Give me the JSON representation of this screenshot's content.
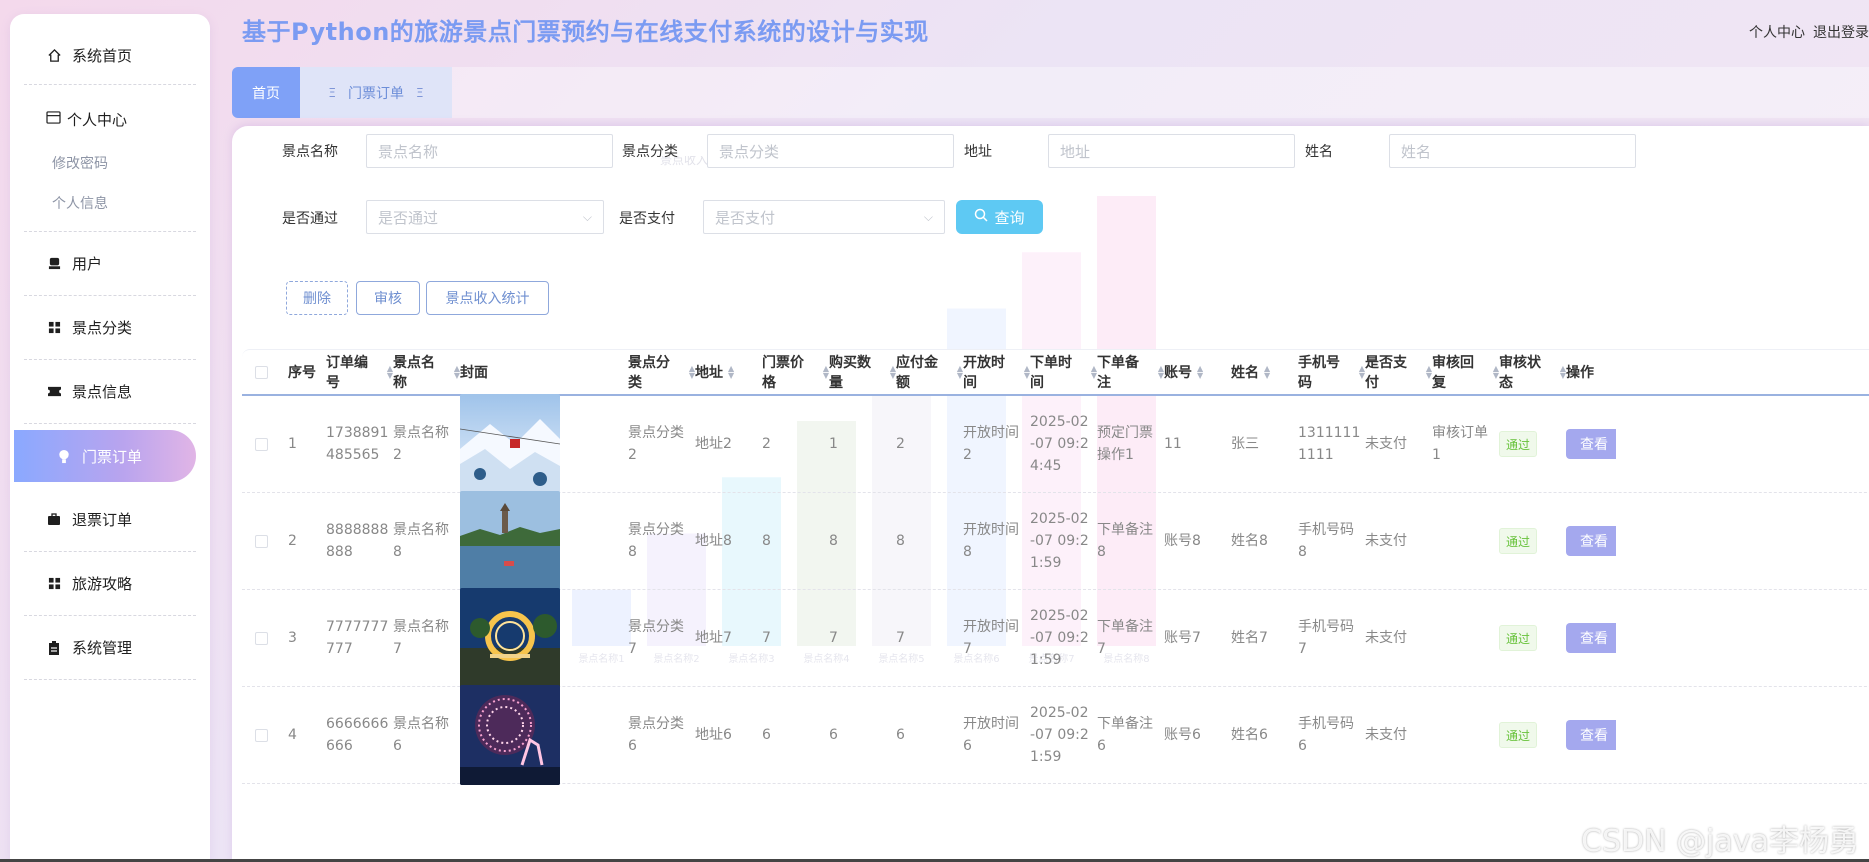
{
  "header": {
    "title": "基于Python的旅游景点门票预约与在线支付系统的设计与实现",
    "personal_center": "个人中心",
    "logout": "退出登录"
  },
  "sidebar": {
    "home": "系统首页",
    "personal": "个人中心",
    "personal_sub": [
      "修改密码",
      "个人信息"
    ],
    "items": [
      {
        "label": "用户",
        "icon": "user-icon"
      },
      {
        "label": "景点分类",
        "icon": "grid-icon"
      },
      {
        "label": "景点信息",
        "icon": "ticket-icon"
      },
      {
        "label": "门票订单",
        "icon": "bulb-icon"
      },
      {
        "label": "退票订单",
        "icon": "briefcase-icon"
      },
      {
        "label": "旅游攻略",
        "icon": "grid-icon"
      },
      {
        "label": "系统管理",
        "icon": "clipboard-icon"
      }
    ],
    "active": "门票订单"
  },
  "tabs": {
    "home": "首页",
    "order": "门票订单"
  },
  "search": {
    "name_label": "景点名称",
    "name_placeholder": "景点名称",
    "category_label": "景点分类",
    "category_placeholder": "景点分类",
    "address_label": "地址",
    "address_placeholder": "地址",
    "person_label": "姓名",
    "person_placeholder": "姓名",
    "pass_label": "是否通过",
    "pass_placeholder": "是否通过",
    "paid_label": "是否支付",
    "paid_placeholder": "是否支付",
    "query": "查询"
  },
  "actions": {
    "delete": "删除",
    "review": "审核",
    "stats": "景点收入统计"
  },
  "ghost_chart": {
    "title": "景点收入统计",
    "categories": [
      "景点名称1",
      "景点名称2",
      "景点名称3",
      "景点名称4",
      "景点名称5",
      "景点名称6",
      "景点名称7",
      "景点名称8"
    ],
    "values": [
      1,
      2,
      3,
      4,
      5,
      6,
      7,
      8
    ],
    "ylim": [
      0,
      8
    ],
    "colors": [
      "#dfe7ff",
      "#ede8fb",
      "#d6f3fb",
      "#e7eee3",
      "#f1eef6",
      "#e3ecff",
      "#fbe6f5",
      "#fbdcf0"
    ]
  },
  "table": {
    "columns": [
      "序号",
      "订单编号",
      "景点名称",
      "封面",
      "景点分类",
      "地址",
      "门票价格",
      "购买数量",
      "应付金额",
      "开放时间",
      "下单时间",
      "下单备注",
      "账号",
      "姓名",
      "手机号码",
      "是否支付",
      "审核回复",
      "审核状态",
      "操作"
    ],
    "rows": [
      {
        "idx": "1",
        "order_no": "1738891485565",
        "name": "景点名称2",
        "cover": "snow",
        "category": "景点分类2",
        "address": "地址2",
        "price": "2",
        "qty": "1",
        "amount": "2",
        "open": "开放时间2",
        "time": "2025-02-07 09:24:45",
        "note": "预定门票操作1",
        "account": "11",
        "person": "张三",
        "phone": "13111111111",
        "paid": "未支付",
        "reply": "审核订单1",
        "status": "通过",
        "op": "查看"
      },
      {
        "idx": "2",
        "order_no": "8888888888",
        "name": "景点名称8",
        "cover": "lake",
        "category": "景点分类8",
        "address": "地址8",
        "price": "8",
        "qty": "8",
        "amount": "8",
        "open": "开放时间8",
        "time": "2025-02-07 09:21:59",
        "note": "下单备注8",
        "account": "账号8",
        "person": "姓名8",
        "phone": "手机号码8",
        "paid": "未支付",
        "reply": "",
        "status": "通过",
        "op": "查看"
      },
      {
        "idx": "3",
        "order_no": "7777777777",
        "name": "景点名称7",
        "cover": "ring",
        "category": "景点分类7",
        "address": "地址7",
        "price": "7",
        "qty": "7",
        "amount": "7",
        "open": "开放时间7",
        "time": "2025-02-07 09:21:59",
        "note": "下单备注7",
        "account": "账号7",
        "person": "姓名7",
        "phone": "手机号码7",
        "paid": "未支付",
        "reply": "",
        "status": "通过",
        "op": "查看"
      },
      {
        "idx": "4",
        "order_no": "6666666666",
        "name": "景点名称6",
        "cover": "lights",
        "category": "景点分类6",
        "address": "地址6",
        "price": "6",
        "qty": "6",
        "amount": "6",
        "open": "开放时间6",
        "time": "2025-02-07 09:21:59",
        "note": "下单备注6",
        "account": "账号6",
        "person": "姓名6",
        "phone": "手机号码6",
        "paid": "未支付",
        "reply": "",
        "status": "通过",
        "op": "查看"
      }
    ]
  },
  "watermark": "CSDN @java李杨勇"
}
